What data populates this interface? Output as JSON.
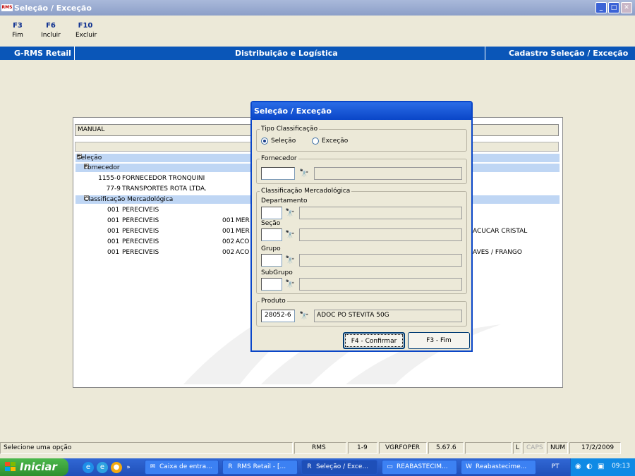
{
  "window": {
    "title": "Seleção / Exceção",
    "app_icon_text": "RMS",
    "min": "_",
    "max": "□",
    "close": "✕"
  },
  "fkeys": [
    {
      "key": "F3",
      "label": "Fim"
    },
    {
      "key": "F6",
      "label": "Incluir"
    },
    {
      "key": "F10",
      "label": "Excluir"
    }
  ],
  "header": {
    "left": "G-RMS Retail",
    "center": "Distribuição e Logística",
    "right": "Cadastro Seleção / Exceção"
  },
  "panel": {
    "type_field": "MANUAL",
    "tree": [
      {
        "label": "Seleção",
        "level": 0,
        "highlight": true,
        "expander": "−"
      },
      {
        "label": "Fornecedor",
        "level": 1,
        "highlight": true,
        "expander": "−"
      },
      {
        "code": "1155-0",
        "name": "FORNECEDOR TRONQUINI",
        "level": 2
      },
      {
        "code": "77-9",
        "name": "TRANSPORTES ROTA LTDA.",
        "level": 2
      },
      {
        "label": "Classificação Mercadológica",
        "level": 1,
        "highlight": true,
        "expander": "−"
      },
      {
        "code": "001",
        "name": "PERECIVEIS",
        "level": 2
      },
      {
        "code": "001",
        "name": "PERECIVEIS",
        "level": 2,
        "c2": "001",
        "n2": "MER",
        "extra": ""
      },
      {
        "code": "001",
        "name": "PERECIVEIS",
        "level": 2,
        "c2": "001",
        "n2": "MER",
        "extra": "ACUCAR CRISTAL"
      },
      {
        "code": "001",
        "name": "PERECIVEIS",
        "level": 2,
        "c2": "002",
        "n2": "ACO",
        "extra": ""
      },
      {
        "code": "001",
        "name": "PERECIVEIS",
        "level": 2,
        "c2": "002",
        "n2": "ACO",
        "extra": "AVES / FRANGO"
      }
    ]
  },
  "dialog": {
    "title": "Seleção / Exceção",
    "tipo_label": "Tipo Classificação",
    "radio_selecao": "Seleção",
    "radio_excecao": "Exceção",
    "fornecedor_label": "Fornecedor",
    "fornecedor_value": "",
    "classif_label": "Classificação Mercadológica",
    "departamento_label": "Departamento",
    "secao_label": "Seção",
    "grupo_label": "Grupo",
    "subgrupo_label": "SubGrupo",
    "produto_label": "Produto",
    "produto_code": "28052-6",
    "produto_desc": "ADOC PO STEVITA 50G",
    "confirm_button": "F4 - Confirmar",
    "fim_button": "F3 - Fim"
  },
  "status": {
    "message": "Selecione uma opção",
    "system": "RMS",
    "range": "1-9",
    "user": "VGRFOPER",
    "version": "5.67.6",
    "blank": "",
    "l": "L",
    "caps": "CAPS",
    "num": "NUM",
    "date": "17/2/2009"
  },
  "taskbar": {
    "start": "Iniciar",
    "more": "»",
    "tasks": [
      "Caixa de entra...",
      "RMS Retail - [...",
      "Seleção / Exce...",
      "REABASTECIM...",
      "Reabastecime..."
    ],
    "lang": "PT",
    "clock": "09:13"
  }
}
